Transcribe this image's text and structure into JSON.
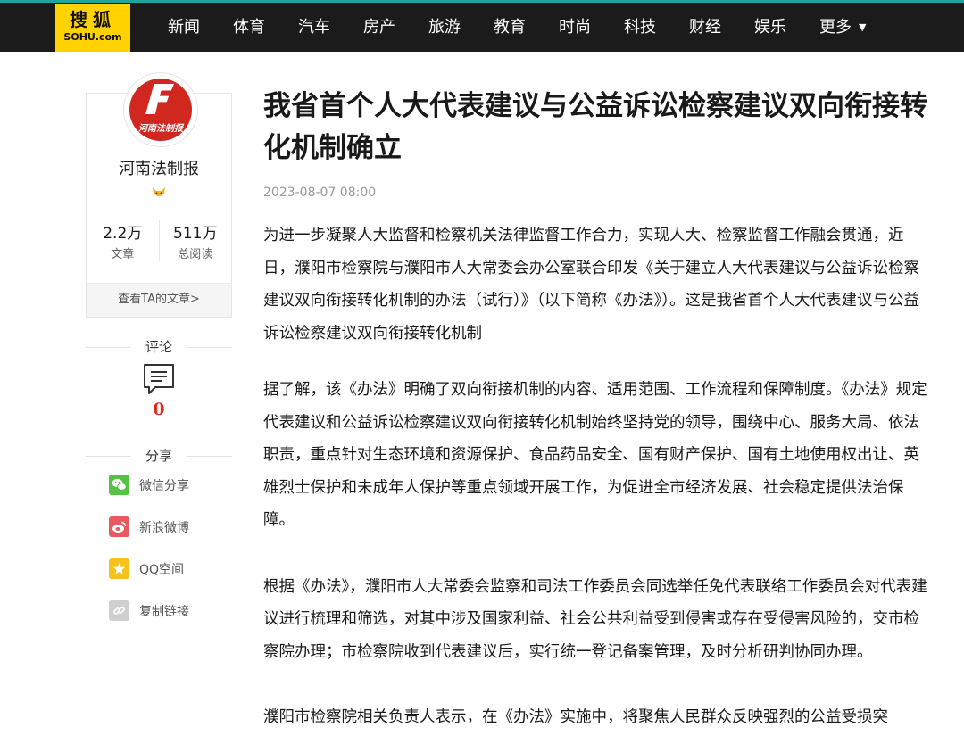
{
  "header": {
    "logo_top": "搜狐",
    "logo_bottom": "SOHU.com",
    "nav": [
      "新闻",
      "体育",
      "汽车",
      "房产",
      "旅游",
      "教育",
      "时尚",
      "科技",
      "财经",
      "娱乐"
    ],
    "more": "更多"
  },
  "author": {
    "avatar_text": "河南法制报",
    "name": "河南法制报",
    "articles_count": "2.2万",
    "articles_label": "文章",
    "reads_count": "511万",
    "reads_label": "总阅读",
    "view_more": "查看TA的文章>"
  },
  "comments": {
    "label": "评论",
    "count": "0"
  },
  "share": {
    "label": "分享",
    "items": [
      "微信分享",
      "新浪微博",
      "QQ空间",
      "复制链接"
    ]
  },
  "article": {
    "title": "我省首个人大代表建议与公益诉讼检察建议双向衔接转化机制确立",
    "time": "2023-08-07 08:00",
    "paragraphs": [
      "为进一步凝聚人大监督和检察机关法律监督工作合力，实现人大、检察监督工作融会贯通，近日，濮阳市检察院与濮阳市人大常委会办公室联合印发《关于建立人大代表建议与公益诉讼检察建议双向衔接转化机制的办法（试行）》（以下简称《办法》）。这是我省首个人大代表建议与公益诉讼检察建议双向衔接转化机制",
      "据了解，该《办法》明确了双向衔接机制的内容、适用范围、工作流程和保障制度。《办法》规定代表建议和公益诉讼检察建议双向衔接转化机制始终坚持党的领导，围绕中心、服务大局、依法职责，重点针对生态环境和资源保护、食品药品安全、国有财产保护、国有土地使用权出让、英雄烈士保护和未成年人保护等重点领域开展工作，为促进全市经济发展、社会稳定提供法治保障。",
      "根据《办法》，濮阳市人大常委会监察和司法工作委员会同选举任免代表联络工作委员会对代表建议进行梳理和筛选，对其中涉及国家利益、社会公共利益受到侵害或存在受侵害风险的，交市检察院办理；市检察院收到代表建议后，实行统一登记备案管理，及时分析研判协同办理。",
      "濮阳市检察院相关负责人表示，在《办法》实施中，将聚焦人民群众反映强烈的公益受损突"
    ]
  },
  "colors": {
    "topbar_bg": "#1b1b1b",
    "logo_bg": "#ffd200",
    "comment_count": "#e12b1c",
    "wechat": "#55c244",
    "weibo": "#e8585f",
    "qzone": "#f6c21c",
    "copy_link": "#cfcfcf"
  },
  "icons": {
    "comment": "comment-icon",
    "wechat": "wechat-icon",
    "weibo": "weibo-icon",
    "qzone": "qzone-icon",
    "copy_link": "link-icon",
    "badge": "fox-badge-icon"
  }
}
